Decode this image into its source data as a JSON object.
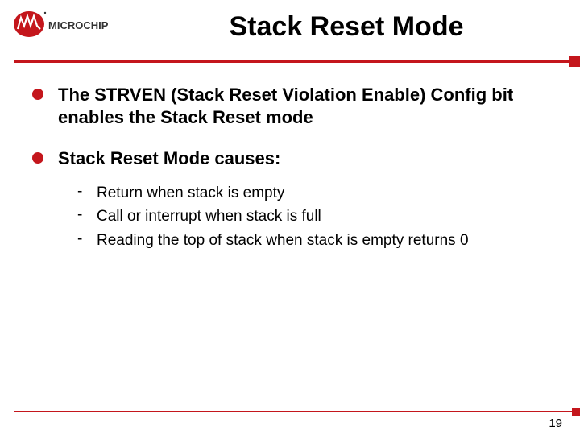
{
  "brand": "MICROCHIP",
  "title": "Stack Reset Mode",
  "bullets": [
    {
      "text": "The STRVEN (Stack Reset Violation Enable) Config bit enables the Stack Reset mode",
      "subs": []
    },
    {
      "text": "Stack Reset Mode causes:",
      "subs": [
        "Return when stack is empty",
        "Call or interrupt when stack is full",
        "Reading the top of stack when stack is empty returns 0"
      ]
    }
  ],
  "page_number": "19"
}
